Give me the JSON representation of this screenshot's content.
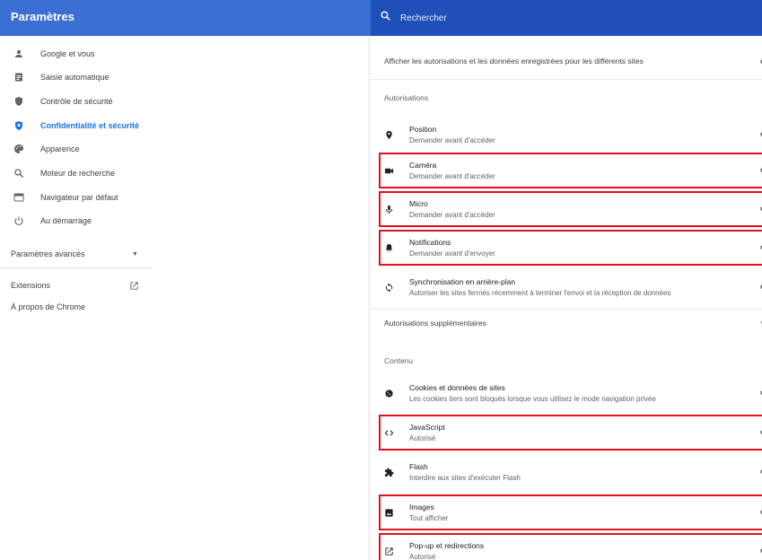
{
  "app": {
    "title": "Paramètres"
  },
  "search": {
    "placeholder": "Rechercher"
  },
  "sidebar": {
    "items": [
      {
        "label": "Google et vous",
        "icon": "person-icon"
      },
      {
        "label": "Saisie automatique",
        "icon": "clipboard-icon"
      },
      {
        "label": "Contrôle de sécurité",
        "icon": "shield-icon"
      },
      {
        "label": "Confidentialité et sécurité",
        "icon": "shield-lock-icon",
        "active": true
      },
      {
        "label": "Apparence",
        "icon": "palette-icon"
      },
      {
        "label": "Moteur de recherche",
        "icon": "search-icon"
      },
      {
        "label": "Navigateur par défaut",
        "icon": "browser-icon"
      },
      {
        "label": "Au démarrage",
        "icon": "power-icon"
      }
    ],
    "advanced": "Paramètres avancés",
    "extensions": "Extensions",
    "about": "À propos de Chrome"
  },
  "main": {
    "view_all": "Afficher les autorisations et les données enregistrées pour les différents sites",
    "permissions_header": "Autorisations",
    "permissions": [
      {
        "title": "Position",
        "subtitle": "Demander avant d'accéder",
        "icon": "location-pin-icon"
      },
      {
        "title": "Caméra",
        "subtitle": "Demander avant d'accéder",
        "icon": "camera-icon"
      },
      {
        "title": "Micro",
        "subtitle": "Demander avant d'accéder",
        "icon": "microphone-icon"
      },
      {
        "title": "Notifications",
        "subtitle": "Demander avant d'envoyer",
        "icon": "bell-icon"
      },
      {
        "title": "Synchronisation en arrière-plan",
        "subtitle": "Autoriser les sites fermés récemment à terminer l'envoi et la réception de données",
        "icon": "sync-icon"
      }
    ],
    "additional": "Autorisations supplémentaires",
    "content_header": "Contenu",
    "content": [
      {
        "title": "Cookies et données de sites",
        "subtitle": "Les cookies tiers sont bloqués lorsque vous utilisez le mode navigation privée",
        "icon": "cookie-icon"
      },
      {
        "title": "JavaScript",
        "subtitle": "Autorisé",
        "icon": "code-icon"
      },
      {
        "title": "Flash",
        "subtitle": "Interdire aux sites d'exécuter Flash",
        "icon": "puzzle-icon"
      },
      {
        "title": "Images",
        "subtitle": "Tout afficher",
        "icon": "image-icon"
      },
      {
        "title": "Pop-up et redirections",
        "subtitle": "Autorisé",
        "icon": "open-in-new-icon"
      }
    ]
  },
  "colors": {
    "header": "#3c6fd4",
    "search_bar": "#1f4fb8",
    "active_item": "#1a73e8",
    "highlight_box": "#e3101b"
  }
}
